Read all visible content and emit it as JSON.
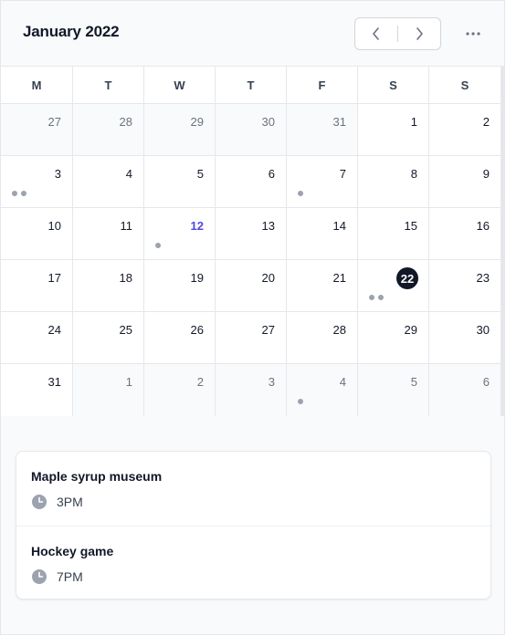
{
  "header": {
    "title": "January 2022",
    "prev_icon": "chevron-left-icon",
    "next_icon": "chevron-right-icon",
    "more_icon": "ellipsis-icon"
  },
  "weekdays": [
    "M",
    "T",
    "W",
    "T",
    "F",
    "S",
    "S"
  ],
  "weeks": [
    [
      {
        "n": "27",
        "out": true
      },
      {
        "n": "28",
        "out": true
      },
      {
        "n": "29",
        "out": true
      },
      {
        "n": "30",
        "out": true
      },
      {
        "n": "31",
        "out": true
      },
      {
        "n": "1"
      },
      {
        "n": "2"
      }
    ],
    [
      {
        "n": "3",
        "dots": 2
      },
      {
        "n": "4"
      },
      {
        "n": "5"
      },
      {
        "n": "6"
      },
      {
        "n": "7",
        "dots": 1
      },
      {
        "n": "8"
      },
      {
        "n": "9"
      }
    ],
    [
      {
        "n": "10"
      },
      {
        "n": "11"
      },
      {
        "n": "12",
        "today": true,
        "dots": 1
      },
      {
        "n": "13"
      },
      {
        "n": "14"
      },
      {
        "n": "15"
      },
      {
        "n": "16"
      }
    ],
    [
      {
        "n": "17"
      },
      {
        "n": "18"
      },
      {
        "n": "19"
      },
      {
        "n": "20"
      },
      {
        "n": "21"
      },
      {
        "n": "22",
        "selected": true,
        "dots": 2
      },
      {
        "n": "23"
      }
    ],
    [
      {
        "n": "24"
      },
      {
        "n": "25"
      },
      {
        "n": "26"
      },
      {
        "n": "27"
      },
      {
        "n": "28"
      },
      {
        "n": "29"
      },
      {
        "n": "30"
      }
    ],
    [
      {
        "n": "31"
      },
      {
        "n": "1",
        "out": true
      },
      {
        "n": "2",
        "out": true
      },
      {
        "n": "3",
        "out": true
      },
      {
        "n": "4",
        "out": true,
        "dots": 1
      },
      {
        "n": "5",
        "out": true
      },
      {
        "n": "6",
        "out": true
      }
    ]
  ],
  "events": [
    {
      "name": "Maple syrup museum",
      "time": "3PM",
      "icon": "clock-icon"
    },
    {
      "name": "Hockey game",
      "time": "7PM",
      "icon": "clock-icon"
    }
  ],
  "colors": {
    "accent": "#4f46e5",
    "selected_bg": "#111827",
    "dot": "#9ca3af",
    "border": "#e5e7eb"
  }
}
